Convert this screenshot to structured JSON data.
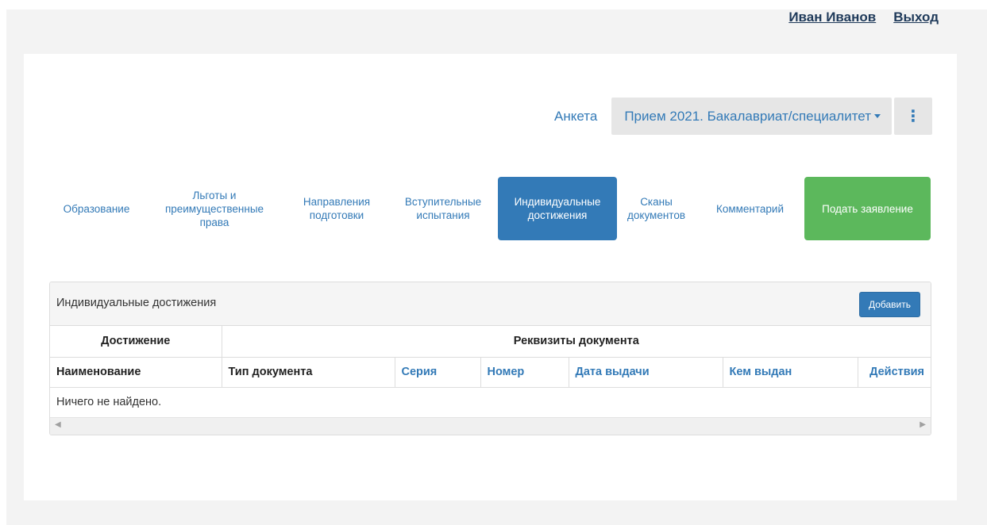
{
  "header": {
    "user_name": "Иван Иванов",
    "logout": "Выход"
  },
  "anketa": {
    "link": "Анкета",
    "campaign": "Прием 2021. Бакалавриат/специалитет",
    "more_icon": "vertical-ellipsis-icon"
  },
  "tabs": [
    {
      "label": "Образование"
    },
    {
      "label": "Льготы и преимущественные права"
    },
    {
      "label": "Направления подготовки"
    },
    {
      "label": "Вступительные испытания"
    },
    {
      "label": "Индивидуальные достижения",
      "active": true
    },
    {
      "label": "Сканы документов"
    },
    {
      "label": "Комментарий"
    },
    {
      "label": "Подать заявление"
    }
  ],
  "achievements": {
    "title": "Индивидуальные достижения",
    "add_button": "Добавить",
    "group_headers": {
      "achievement": "Достижение",
      "document": "Реквизиты документа"
    },
    "columns": [
      "Наименование",
      "Тип документа",
      "Серия",
      "Номер",
      "Дата выдачи",
      "Кем выдан",
      "Действия"
    ],
    "empty_text": "Ничего не найдено."
  },
  "colors": {
    "primary": "#337ab7",
    "success": "#5cb85c",
    "page_bg": "#f3f3f3"
  }
}
